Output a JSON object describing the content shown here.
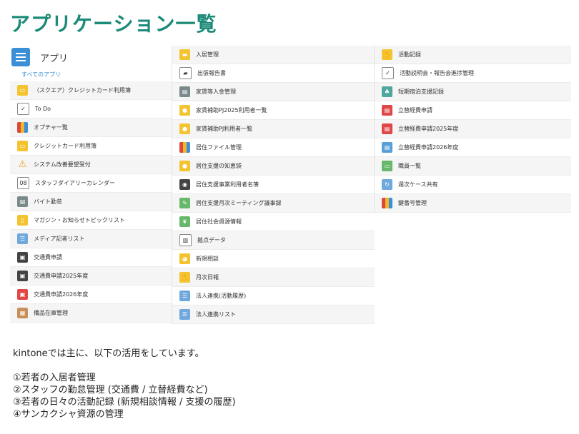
{
  "page_title": "アプリケーション一覧",
  "panel": {
    "header_label": "アプリ",
    "all_apps_link": "すべてのアプリ",
    "columns": [
      [
        {
          "label": "（スクエア）クレジットカード利用簿",
          "icon": "credit-card-icon"
        },
        {
          "label": "To Do",
          "icon": "checklist-icon"
        },
        {
          "label": "オプチャ一覧",
          "icon": "books-icon"
        },
        {
          "label": "クレジットカード利用簿",
          "icon": "credit-card-icon"
        },
        {
          "label": "システム改善要望受付",
          "icon": "warning-icon"
        },
        {
          "label": "スタッフダイアリーカレンダー",
          "icon": "calendar-icon"
        },
        {
          "label": "バイト勤怠",
          "icon": "timecard-icon"
        },
        {
          "label": "マガジン・お知らせトピックリスト",
          "icon": "document-icon"
        },
        {
          "label": "メディア記者リスト",
          "icon": "list-icon"
        },
        {
          "label": "交通費申請",
          "icon": "train-icon"
        },
        {
          "label": "交通費申請2025年度",
          "icon": "train-icon"
        },
        {
          "label": "交通費申請2026年度",
          "icon": "train-red-icon"
        },
        {
          "label": "備品在庫管理",
          "icon": "boxes-icon"
        }
      ],
      [
        {
          "label": "入居管理",
          "icon": "folder-icon"
        },
        {
          "label": "出張報告書",
          "icon": "car-icon"
        },
        {
          "label": "家賃等入金管理",
          "icon": "ledger-icon"
        },
        {
          "label": "家賃補助PJ2025利用者一覧",
          "icon": "bulb-icon"
        },
        {
          "label": "家賃補助PJ利用者一覧",
          "icon": "bulb-icon"
        },
        {
          "label": "居住ファイル管理",
          "icon": "books-icon"
        },
        {
          "label": "居住支援の知恵袋",
          "icon": "bulb-icon"
        },
        {
          "label": "居住支援事業利用者名簿",
          "icon": "baseball-icon"
        },
        {
          "label": "居住支援月次ミーティング議事録",
          "icon": "pencil-icon"
        },
        {
          "label": "居住社会資源情報",
          "icon": "leaf-icon"
        },
        {
          "label": "拠点データ",
          "icon": "building-icon"
        },
        {
          "label": "新規相談",
          "icon": "chick-icon"
        },
        {
          "label": "月次日報",
          "icon": "thumbs-up-icon"
        },
        {
          "label": "法人連携(活動履歴)",
          "icon": "list-icon"
        },
        {
          "label": "法人連携リスト",
          "icon": "list-icon"
        }
      ],
      [
        {
          "label": "活動記録",
          "icon": "thumbs-up-icon"
        },
        {
          "label": "活動説明会・報告会進捗管理",
          "icon": "checklist-icon"
        },
        {
          "label": "短期宿泊支援記録",
          "icon": "tree-icon"
        },
        {
          "label": "立替経費申請",
          "icon": "receipt-icon"
        },
        {
          "label": "立替経費申請2025年度",
          "icon": "receipt-icon"
        },
        {
          "label": "立替経費申請2026年度",
          "icon": "receipt-blue-icon"
        },
        {
          "label": "職員一覧",
          "icon": "id-card-icon"
        },
        {
          "label": "週次ケース共有",
          "icon": "share-icon"
        },
        {
          "label": "鍵番号管理",
          "icon": "books-icon"
        }
      ]
    ]
  },
  "body_lines": [
    "kintoneでは主に、以下の活用をしています。",
    "",
    "①若者の入居者管理",
    "②スタッフの勤怠管理 (交通費 / 立替経費など)",
    "③若者の日々の活動記録 (新規相談情報 / 支援の履歴)",
    "④サンカクシャ資源の管理"
  ]
}
